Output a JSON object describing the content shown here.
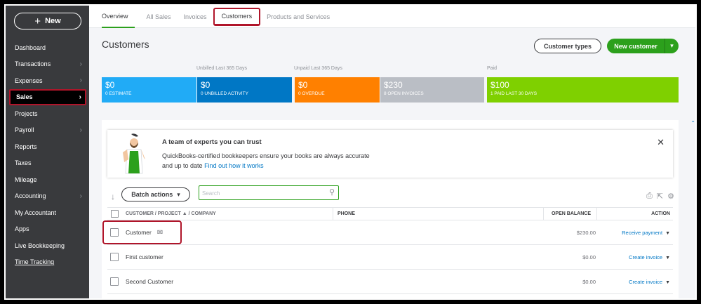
{
  "sidebar": {
    "new_label": "New",
    "items": [
      {
        "label": "Dashboard",
        "chevron": false
      },
      {
        "label": "Transactions",
        "chevron": true
      },
      {
        "label": "Expenses",
        "chevron": true
      },
      {
        "label": "Sales",
        "chevron": true
      },
      {
        "label": "Projects",
        "chevron": false
      },
      {
        "label": "Payroll",
        "chevron": true
      },
      {
        "label": "Reports",
        "chevron": false
      },
      {
        "label": "Taxes",
        "chevron": false
      },
      {
        "label": "Mileage",
        "chevron": false
      },
      {
        "label": "Accounting",
        "chevron": true
      },
      {
        "label": "My Accountant",
        "chevron": false
      },
      {
        "label": "Apps",
        "chevron": false
      },
      {
        "label": "Live Bookkeeping",
        "chevron": false
      },
      {
        "label": "Time Tracking",
        "chevron": false
      }
    ]
  },
  "tabs": {
    "overview": "Overview",
    "all_sales": "All Sales",
    "invoices": "Invoices",
    "customers": "Customers",
    "products": "Products and Services"
  },
  "header": {
    "title": "Customers",
    "customer_types": "Customer types",
    "new_customer": "New customer"
  },
  "money_bar": {
    "unbilled_label": "Unbilled Last 365 Days",
    "unpaid_label": "Unpaid Last 365 Days",
    "paid_label": "Paid",
    "estimate_amt": "$0",
    "estimate_sub": "0 ESTIMATE",
    "unbilled_amt": "$0",
    "unbilled_sub": "0 UNBILLED ACTIVITY",
    "overdue_amt": "$0",
    "overdue_sub": "0 OVERDUE",
    "open_amt": "$230",
    "open_sub": "8 OPEN INVOICES",
    "paid_amt": "$100",
    "paid_sub": "1 PAID LAST 30 DAYS",
    "colors": {
      "estimate": "#21abf6",
      "unbilled": "#0077c5",
      "overdue": "#ff8000",
      "open": "#babec5",
      "paid": "#7fd000"
    }
  },
  "promo": {
    "title": "A team of experts you can trust",
    "line1": "QuickBooks-certified bookkeepers ensure your books are always accurate",
    "line2": "and up to date ",
    "link": "Find out how it works"
  },
  "toolbar": {
    "batch_actions": "Batch actions",
    "search_placeholder": "Search"
  },
  "table": {
    "col_name": "CUSTOMER / PROJECT ▲ / COMPANY",
    "col_phone": "PHONE",
    "col_balance": "OPEN BALANCE",
    "col_action": "ACTION",
    "rows": [
      {
        "name": "Customer",
        "phone": "",
        "balance": "$230.00",
        "action": "Receive payment"
      },
      {
        "name": "First customer",
        "phone": "",
        "balance": "$0.00",
        "action": "Create invoice"
      },
      {
        "name": "Second Customer",
        "phone": "",
        "balance": "$0.00",
        "action": "Create invoice"
      }
    ]
  }
}
